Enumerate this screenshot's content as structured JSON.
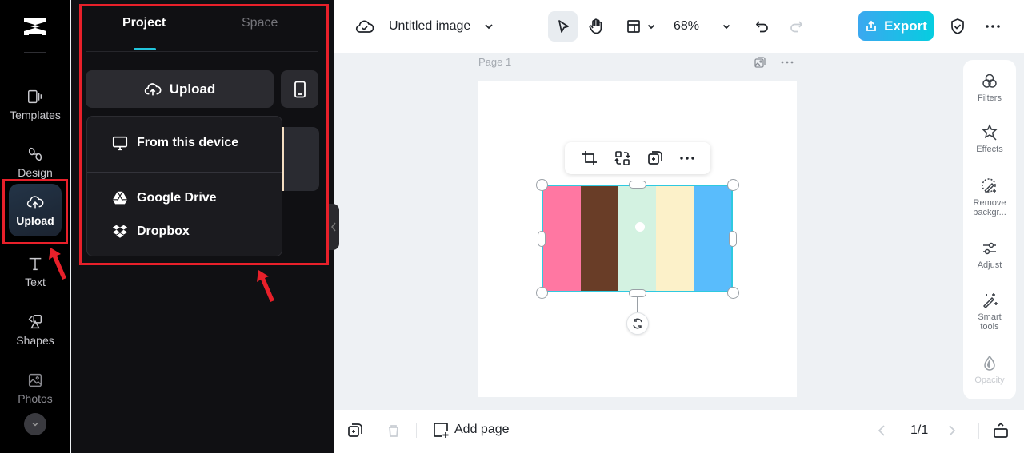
{
  "rail": {
    "items": [
      {
        "label": "Templates",
        "icon": "templates-icon"
      },
      {
        "label": "Design",
        "icon": "design-icon"
      },
      {
        "label": "Upload",
        "icon": "cloud-upload-icon",
        "active": true
      },
      {
        "label": "Text",
        "icon": "text-icon"
      },
      {
        "label": "Shapes",
        "icon": "shapes-icon"
      },
      {
        "label": "Photos",
        "icon": "photos-icon"
      }
    ],
    "more_icon": "chevron-down-icon"
  },
  "panel": {
    "tabs": [
      {
        "label": "Project",
        "active": true
      },
      {
        "label": "Space",
        "active": false
      }
    ],
    "upload_label": "Upload",
    "phone_icon": "phone-icon",
    "dropdown": [
      {
        "label": "From this device",
        "icon": "monitor-icon"
      },
      {
        "label": "Google Drive",
        "icon": "google-drive-icon"
      },
      {
        "label": "Dropbox",
        "icon": "dropbox-icon"
      }
    ]
  },
  "topbar": {
    "title": "Untitled image",
    "zoom": "68%",
    "export_label": "Export",
    "accent": "#22c5dc"
  },
  "canvas": {
    "page_label": "Page 1",
    "stripe_colors": [
      "#ff77a2",
      "#693d27",
      "#d3f2e1",
      "#fcf1c9",
      "#59bcfc"
    ],
    "selection_color": "#2fc9e0"
  },
  "rightpanel": {
    "items": [
      {
        "label": "Filters"
      },
      {
        "label": "Effects"
      },
      {
        "label": "Remove backgr..."
      },
      {
        "label": "Adjust"
      },
      {
        "label": "Smart tools"
      },
      {
        "label": "Opacity",
        "disabled": true
      }
    ]
  },
  "bottombar": {
    "add_page_label": "Add page",
    "page_counter": "1/1"
  }
}
